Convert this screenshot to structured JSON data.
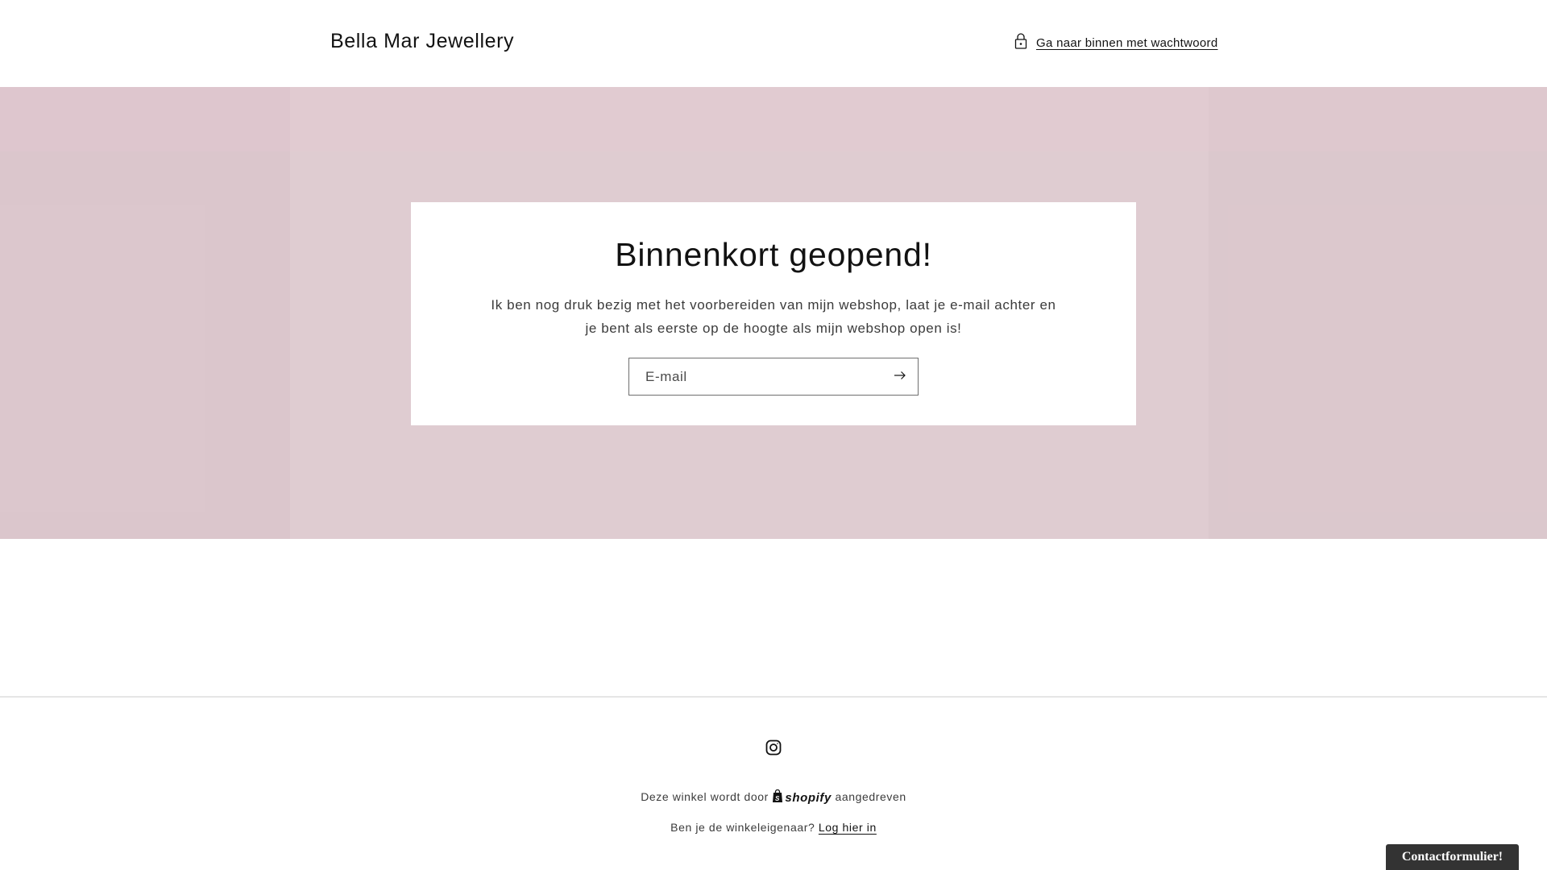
{
  "header": {
    "brand": "Bella Mar Jewellery",
    "password_link": "Ga naar binnen met wachtwoord",
    "lock_icon": "lock-icon"
  },
  "hero": {
    "background_color": "#dfccd1",
    "title": "Binnenkort geopend!",
    "description": "Ik ben nog druk bezig met het voorbereiden van mijn webshop, laat je e-mail achter en je bent als eerste op de hoogte als mijn webshop open is!",
    "email_placeholder": "E-mail",
    "submit_icon": "arrow-right-icon"
  },
  "footer": {
    "social_icon": "instagram-icon",
    "powered_prefix": "Deze winkel wordt door",
    "powered_brand": "shopify",
    "powered_suffix": "aangedreven",
    "owner_question": "Ben je de winkeleigenaar?",
    "owner_login": "Log hier in"
  },
  "widgets": {
    "contact_tab": "Contactformulier!"
  }
}
